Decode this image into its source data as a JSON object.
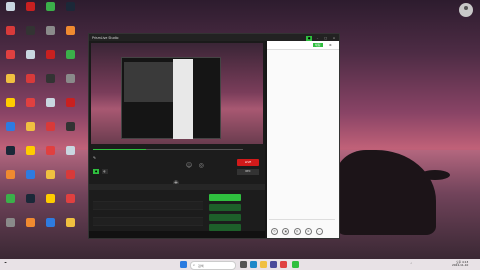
{
  "desktop": {
    "icons": [
      {
        "name": "recycle-bin",
        "color": "#c9d6e0"
      },
      {
        "name": "app-icon-red",
        "color": "#d83a3a"
      },
      {
        "name": "chrome",
        "color": "#e04040"
      },
      {
        "name": "folder",
        "color": "#f0c040"
      },
      {
        "name": "app-icon-yellow",
        "color": "#ffcc00"
      },
      {
        "name": "app-icon-blue",
        "color": "#2e7be0"
      },
      {
        "name": "steam",
        "color": "#1b2838"
      },
      {
        "name": "app-icon-orange",
        "color": "#f08a30"
      },
      {
        "name": "app-icon-green",
        "color": "#3bb04a"
      },
      {
        "name": "app-icon-gray",
        "color": "#8a8a8a"
      },
      {
        "name": "app-icon-red2",
        "color": "#c92020"
      },
      {
        "name": "app-icon-dark",
        "color": "#333333"
      }
    ]
  },
  "window": {
    "title": "PrismLive Studio",
    "live_label": "LIVE",
    "rec_label": "REC",
    "seek_progress": 0.35
  },
  "chat": {
    "tab_label": "채팅"
  },
  "taskbar": {
    "search_placeholder": "검색",
    "clock_time": "오후 4:13",
    "clock_date": "2024-11-10"
  },
  "colors": {
    "accent_green": "#2fbf3f",
    "live_red": "#d21a1a"
  }
}
